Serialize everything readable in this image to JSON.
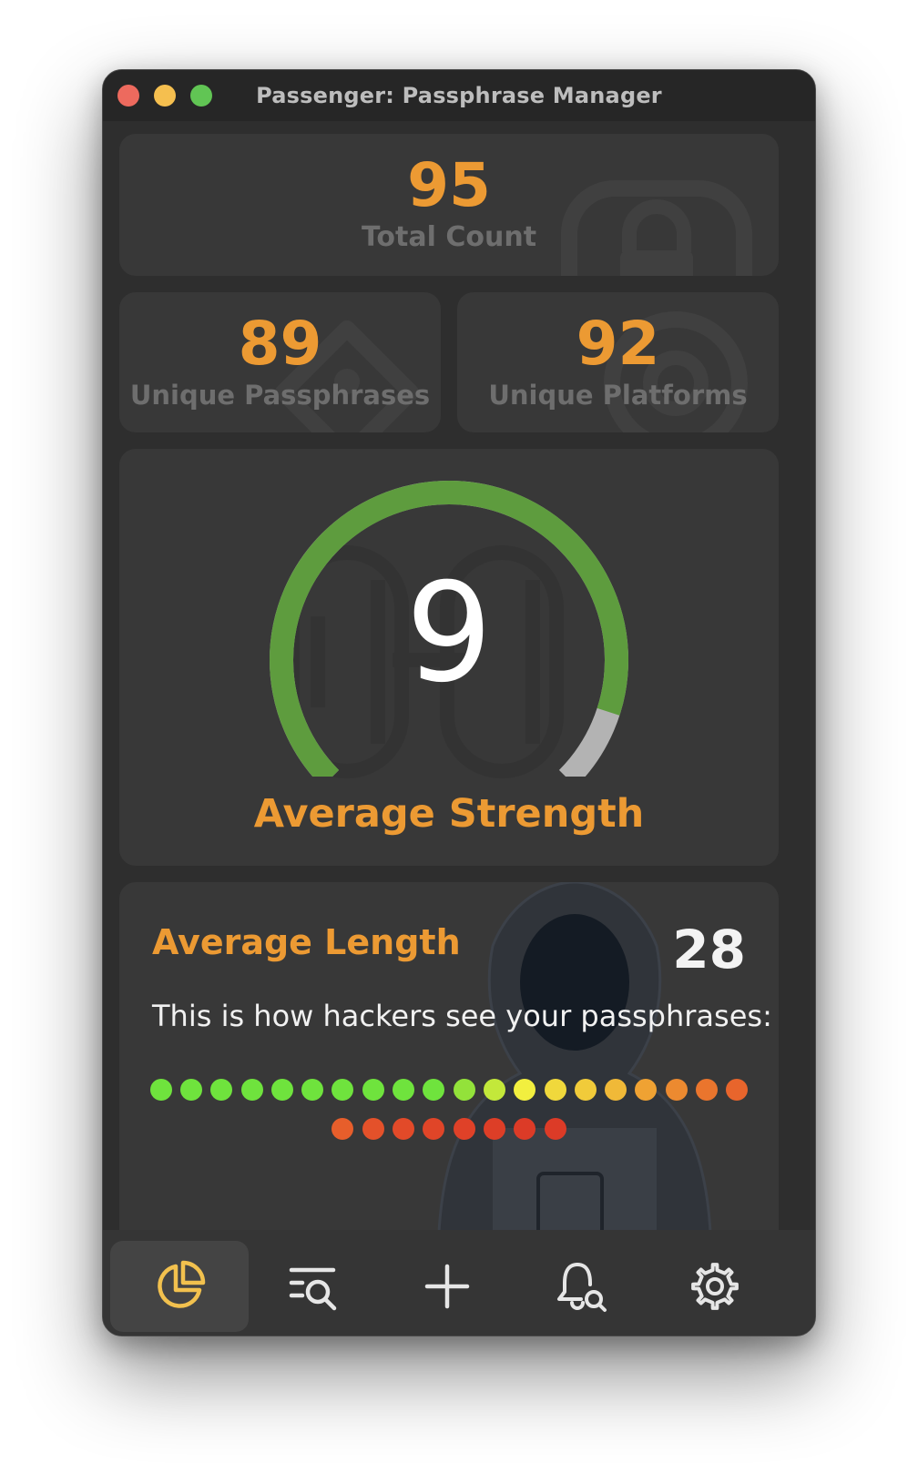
{
  "window": {
    "title": "Passenger: Passphrase Manager"
  },
  "stats": {
    "total_count": {
      "value": "95",
      "label": "Total Count"
    },
    "unique_passphrases": {
      "value": "89",
      "label": "Unique Passphrases"
    },
    "unique_platforms": {
      "value": "92",
      "label": "Unique Platforms"
    }
  },
  "strength": {
    "value": "9",
    "label": "Average Strength",
    "fraction": 0.9,
    "colors": {
      "fill": "#5e9c3e",
      "track": "#b3b3b3"
    }
  },
  "length": {
    "title": "Average Length",
    "value": "28",
    "description": "This is how hackers see your passphrases:",
    "dot_count": 28,
    "dot_colors": [
      "#6fe33d",
      "#6fe33d",
      "#6fe33d",
      "#6fe33d",
      "#6fe33d",
      "#6fe33d",
      "#6fe33d",
      "#6fe33d",
      "#6fe33d",
      "#6fe33d",
      "#93e23a",
      "#c3e83a",
      "#f2ef3f",
      "#f0d83c",
      "#f1cb3a",
      "#f0b938",
      "#efa233",
      "#ec8a30",
      "#ea752d",
      "#e8652c",
      "#e75e2b",
      "#e4512a",
      "#e24a29",
      "#e04528",
      "#df4128",
      "#dd3e27",
      "#dc3b27",
      "#dc3b27"
    ]
  },
  "tabs": [
    {
      "name": "statistics",
      "icon": "pie-chart-icon",
      "active": true
    },
    {
      "name": "search",
      "icon": "list-search-icon",
      "active": false
    },
    {
      "name": "add",
      "icon": "plus-icon",
      "active": false
    },
    {
      "name": "notifications",
      "icon": "bell-search-icon",
      "active": false
    },
    {
      "name": "settings",
      "icon": "gear-icon",
      "active": false
    }
  ],
  "colors": {
    "accent": "#ec9a33",
    "card": "#383838",
    "window": "#2e2e2e",
    "active_tab_icon": "#f2c14e",
    "tab_icon": "#e6e6e6"
  }
}
